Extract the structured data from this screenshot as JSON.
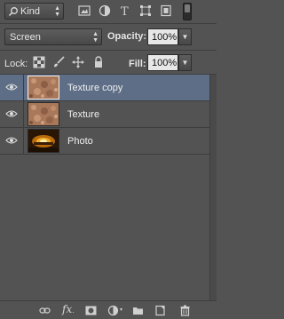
{
  "filter": {
    "kind_label": "Kind",
    "icons": [
      "pixel-filter-icon",
      "adjustment-filter-icon",
      "type-filter-icon",
      "shape-filter-icon",
      "smart-object-filter-icon"
    ]
  },
  "blend": {
    "mode": "Screen",
    "opacity_label": "Opacity:",
    "opacity_value": "100%"
  },
  "lock": {
    "label": "Lock:",
    "icons": [
      "lock-transparent-icon",
      "lock-image-icon",
      "lock-position-icon",
      "lock-all-icon"
    ],
    "fill_label": "Fill:",
    "fill_value": "100%"
  },
  "layers": [
    {
      "name": "Texture copy",
      "selected": true,
      "visible": true
    },
    {
      "name": "Texture",
      "selected": false,
      "visible": true
    },
    {
      "name": "Photo",
      "selected": false,
      "visible": true
    }
  ],
  "bottom_icons": [
    "link-layers-icon",
    "fx-icon",
    "mask-icon",
    "adjustment-layer-icon",
    "group-folder-icon",
    "new-layer-icon",
    "trash-icon"
  ],
  "colors": {
    "panel_bg": "#535353",
    "selected_row": "#5d6e86"
  }
}
